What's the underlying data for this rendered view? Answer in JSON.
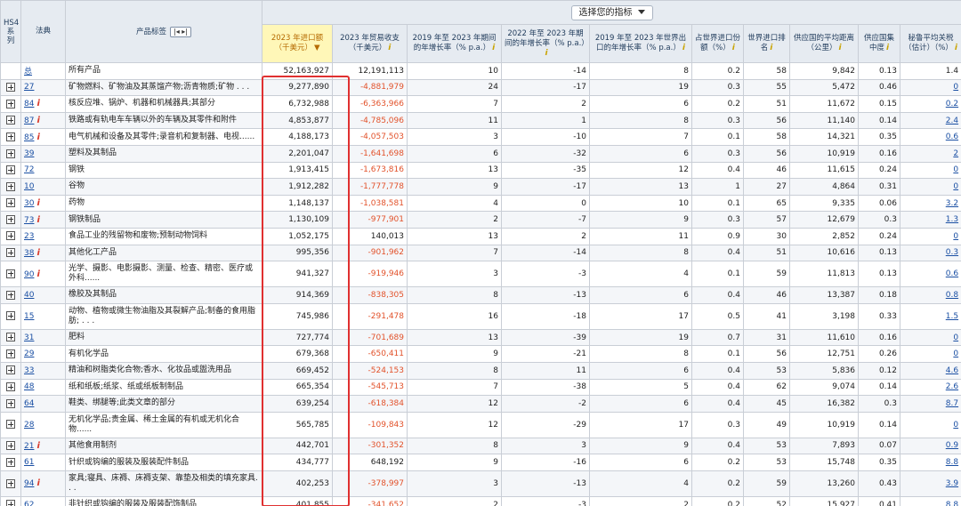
{
  "header": {
    "hs4_label": "HS4\n系\n列",
    "code_label": "法典",
    "product_label": "产品标签",
    "selector": "选择您的指标",
    "columns": [
      {
        "label": "2023 年进口额（千美元）",
        "sort": "▼",
        "highlight": true
      },
      {
        "label": "2023 年贸易收支（千美元）"
      },
      {
        "label": "2019 年至 2023 年期间的年增长率（% p.a.）"
      },
      {
        "label": "2022 年至 2023 年期间的年增长率（% p.a.）"
      },
      {
        "label": "2019 年至 2023 年世界出口的年增长率（% p.a.）"
      },
      {
        "label": "占世界进口份额（%）"
      },
      {
        "label": "世界进口排名"
      },
      {
        "label": "供应国的平均距离（公里）"
      },
      {
        "label": "供应国集中度"
      },
      {
        "label": "秘鲁平均关税（估计）（%）"
      }
    ]
  },
  "rows": [
    {
      "code": "总",
      "info": false,
      "expand": false,
      "label": "所有产品",
      "imp": "52,163,927",
      "bal": "12,191,113",
      "g1": "10",
      "g2": "-14",
      "g3": "8",
      "share": "0.2",
      "rank": "58",
      "dist": "9,842",
      "conc": "0.13",
      "tariff": "1.4",
      "tariff_link": false
    },
    {
      "code": "27",
      "info": false,
      "expand": true,
      "label": "矿物燃料、矿物油及其蒸馏产物;沥青物质;矿物 . . .",
      "imp": "9,277,890",
      "bal": "-4,881,979",
      "g1": "24",
      "g2": "-17",
      "g3": "19",
      "share": "0.3",
      "rank": "55",
      "dist": "5,472",
      "conc": "0.46",
      "tariff": "0",
      "tariff_link": true
    },
    {
      "code": "84",
      "info": true,
      "expand": true,
      "label": "核反应堆、锅炉、机器和机械器具;其部分",
      "imp": "6,732,988",
      "bal": "-6,363,966",
      "g1": "7",
      "g2": "2",
      "g3": "6",
      "share": "0.2",
      "rank": "51",
      "dist": "11,672",
      "conc": "0.15",
      "tariff": "0.2",
      "tariff_link": true
    },
    {
      "code": "87",
      "info": true,
      "expand": true,
      "label": "铁路或有轨电车车辆以外的车辆及其零件和附件",
      "imp": "4,853,877",
      "bal": "-4,785,096",
      "g1": "11",
      "g2": "1",
      "g3": "8",
      "share": "0.3",
      "rank": "56",
      "dist": "11,140",
      "conc": "0.14",
      "tariff": "2.4",
      "tariff_link": true
    },
    {
      "code": "85",
      "info": true,
      "expand": true,
      "label": "电气机械和设备及其零件;录音机和复制器、电视......",
      "imp": "4,188,173",
      "bal": "-4,057,503",
      "g1": "3",
      "g2": "-10",
      "g3": "7",
      "share": "0.1",
      "rank": "58",
      "dist": "14,321",
      "conc": "0.35",
      "tariff": "0.6",
      "tariff_link": true
    },
    {
      "code": "39",
      "info": false,
      "expand": true,
      "label": "塑料及其制品",
      "imp": "2,201,047",
      "bal": "-1,641,698",
      "g1": "6",
      "g2": "-32",
      "g3": "6",
      "share": "0.3",
      "rank": "56",
      "dist": "10,919",
      "conc": "0.16",
      "tariff": "2",
      "tariff_link": true
    },
    {
      "code": "72",
      "info": false,
      "expand": true,
      "label": "钢铁",
      "imp": "1,913,415",
      "bal": "-1,673,816",
      "g1": "13",
      "g2": "-35",
      "g3": "12",
      "share": "0.4",
      "rank": "46",
      "dist": "11,615",
      "conc": "0.24",
      "tariff": "0",
      "tariff_link": true
    },
    {
      "code": "10",
      "info": false,
      "expand": true,
      "label": "谷物",
      "imp": "1,912,282",
      "bal": "-1,777,778",
      "g1": "9",
      "g2": "-17",
      "g3": "13",
      "share": "1",
      "rank": "27",
      "dist": "4,864",
      "conc": "0.31",
      "tariff": "0",
      "tariff_link": true
    },
    {
      "code": "30",
      "info": true,
      "expand": true,
      "label": "药物",
      "imp": "1,148,137",
      "bal": "-1,038,581",
      "g1": "4",
      "g2": "0",
      "g3": "10",
      "share": "0.1",
      "rank": "65",
      "dist": "9,335",
      "conc": "0.06",
      "tariff": "3.2",
      "tariff_link": true
    },
    {
      "code": "73",
      "info": true,
      "expand": true,
      "label": "钢铁制品",
      "imp": "1,130,109",
      "bal": "-977,901",
      "g1": "2",
      "g2": "-7",
      "g3": "9",
      "share": "0.3",
      "rank": "57",
      "dist": "12,679",
      "conc": "0.3",
      "tariff": "1.3",
      "tariff_link": true
    },
    {
      "code": "23",
      "info": false,
      "expand": true,
      "label": "食品工业的残留物和废物;预制动物饲料",
      "imp": "1,052,175",
      "bal": "140,013",
      "g1": "13",
      "g2": "2",
      "g3": "11",
      "share": "0.9",
      "rank": "30",
      "dist": "2,852",
      "conc": "0.24",
      "tariff": "0",
      "tariff_link": true
    },
    {
      "code": "38",
      "info": true,
      "expand": true,
      "label": "其他化工产品",
      "imp": "995,356",
      "bal": "-901,962",
      "g1": "7",
      "g2": "-14",
      "g3": "8",
      "share": "0.4",
      "rank": "51",
      "dist": "10,616",
      "conc": "0.13",
      "tariff": "0.3",
      "tariff_link": true
    },
    {
      "code": "90",
      "info": true,
      "expand": true,
      "label": "光学、摄影、电影摄影、测量、检查、精密、医疗或外科......",
      "imp": "941,327",
      "bal": "-919,946",
      "g1": "3",
      "g2": "-3",
      "g3": "4",
      "share": "0.1",
      "rank": "59",
      "dist": "11,813",
      "conc": "0.13",
      "tariff": "0.6",
      "tariff_link": true,
      "tall": true
    },
    {
      "code": "40",
      "info": false,
      "expand": true,
      "label": "橡胶及其制品",
      "imp": "914,369",
      "bal": "-838,305",
      "g1": "8",
      "g2": "-13",
      "g3": "6",
      "share": "0.4",
      "rank": "46",
      "dist": "13,387",
      "conc": "0.18",
      "tariff": "0.8",
      "tariff_link": true
    },
    {
      "code": "15",
      "info": false,
      "expand": true,
      "label": "动物、植物或微生物油脂及其裂解产品;制备的食用脂肪; . . .",
      "imp": "745,986",
      "bal": "-291,478",
      "g1": "16",
      "g2": "-18",
      "g3": "17",
      "share": "0.5",
      "rank": "41",
      "dist": "3,198",
      "conc": "0.33",
      "tariff": "1.5",
      "tariff_link": true,
      "tall": true
    },
    {
      "code": "31",
      "info": false,
      "expand": true,
      "label": "肥料",
      "imp": "727,774",
      "bal": "-701,689",
      "g1": "13",
      "g2": "-39",
      "g3": "19",
      "share": "0.7",
      "rank": "31",
      "dist": "11,610",
      "conc": "0.16",
      "tariff": "0",
      "tariff_link": true
    },
    {
      "code": "29",
      "info": false,
      "expand": true,
      "label": "有机化学品",
      "imp": "679,368",
      "bal": "-650,411",
      "g1": "9",
      "g2": "-21",
      "g3": "8",
      "share": "0.1",
      "rank": "56",
      "dist": "12,751",
      "conc": "0.26",
      "tariff": "0",
      "tariff_link": true
    },
    {
      "code": "33",
      "info": false,
      "expand": true,
      "label": "精油和树脂类化合物;香水、化妆品或盥洗用品",
      "imp": "669,452",
      "bal": "-524,153",
      "g1": "8",
      "g2": "11",
      "g3": "6",
      "share": "0.4",
      "rank": "53",
      "dist": "5,836",
      "conc": "0.12",
      "tariff": "4.6",
      "tariff_link": true
    },
    {
      "code": "48",
      "info": false,
      "expand": true,
      "label": "纸和纸板;纸浆、纸或纸板制制品",
      "imp": "665,354",
      "bal": "-545,713",
      "g1": "7",
      "g2": "-38",
      "g3": "5",
      "share": "0.4",
      "rank": "62",
      "dist": "9,074",
      "conc": "0.14",
      "tariff": "2.6",
      "tariff_link": true
    },
    {
      "code": "64",
      "info": false,
      "expand": true,
      "label": "鞋类、绑腿等;此类文章的部分",
      "imp": "639,254",
      "bal": "-618,384",
      "g1": "12",
      "g2": "-2",
      "g3": "6",
      "share": "0.4",
      "rank": "45",
      "dist": "16,382",
      "conc": "0.3",
      "tariff": "8.7",
      "tariff_link": true
    },
    {
      "code": "28",
      "info": false,
      "expand": true,
      "label": "无机化学品;贵金属、稀土金属的有机或无机化合物......",
      "imp": "565,785",
      "bal": "-109,843",
      "g1": "12",
      "g2": "-29",
      "g3": "17",
      "share": "0.3",
      "rank": "49",
      "dist": "10,919",
      "conc": "0.14",
      "tariff": "0",
      "tariff_link": true,
      "tall": true
    },
    {
      "code": "21",
      "info": true,
      "expand": true,
      "label": "其他食用制剂",
      "imp": "442,701",
      "bal": "-301,352",
      "g1": "8",
      "g2": "3",
      "g3": "9",
      "share": "0.4",
      "rank": "53",
      "dist": "7,893",
      "conc": "0.07",
      "tariff": "0.9",
      "tariff_link": true
    },
    {
      "code": "61",
      "info": false,
      "expand": true,
      "label": "针织或钩编的服装及服装配件制品",
      "imp": "434,777",
      "bal": "648,192",
      "g1": "9",
      "g2": "-16",
      "g3": "6",
      "share": "0.2",
      "rank": "53",
      "dist": "15,748",
      "conc": "0.35",
      "tariff": "8.8",
      "tariff_link": true
    },
    {
      "code": "94",
      "info": true,
      "expand": true,
      "label": "家具;寝具、床褥、床褥支架、靠垫及相类的填充家具. . .",
      "imp": "402,253",
      "bal": "-378,997",
      "g1": "3",
      "g2": "-13",
      "g3": "4",
      "share": "0.2",
      "rank": "59",
      "dist": "13,260",
      "conc": "0.43",
      "tariff": "3.9",
      "tariff_link": true,
      "tall": true
    },
    {
      "code": "62",
      "info": false,
      "expand": true,
      "label": "非针织或钩编的服装及服装配饰制品",
      "imp": "401,855",
      "bal": "-341,652",
      "g1": "2",
      "g2": "-3",
      "g3": "2",
      "share": "0.2",
      "rank": "52",
      "dist": "15,927",
      "conc": "0.41",
      "tariff": "8.8",
      "tariff_link": true
    }
  ],
  "colors": {
    "header_bg": "#e6ebf1",
    "highlight": "#fff7b8",
    "negative": "#e2522b",
    "link": "#1a4fa3",
    "box": "#e03030"
  }
}
